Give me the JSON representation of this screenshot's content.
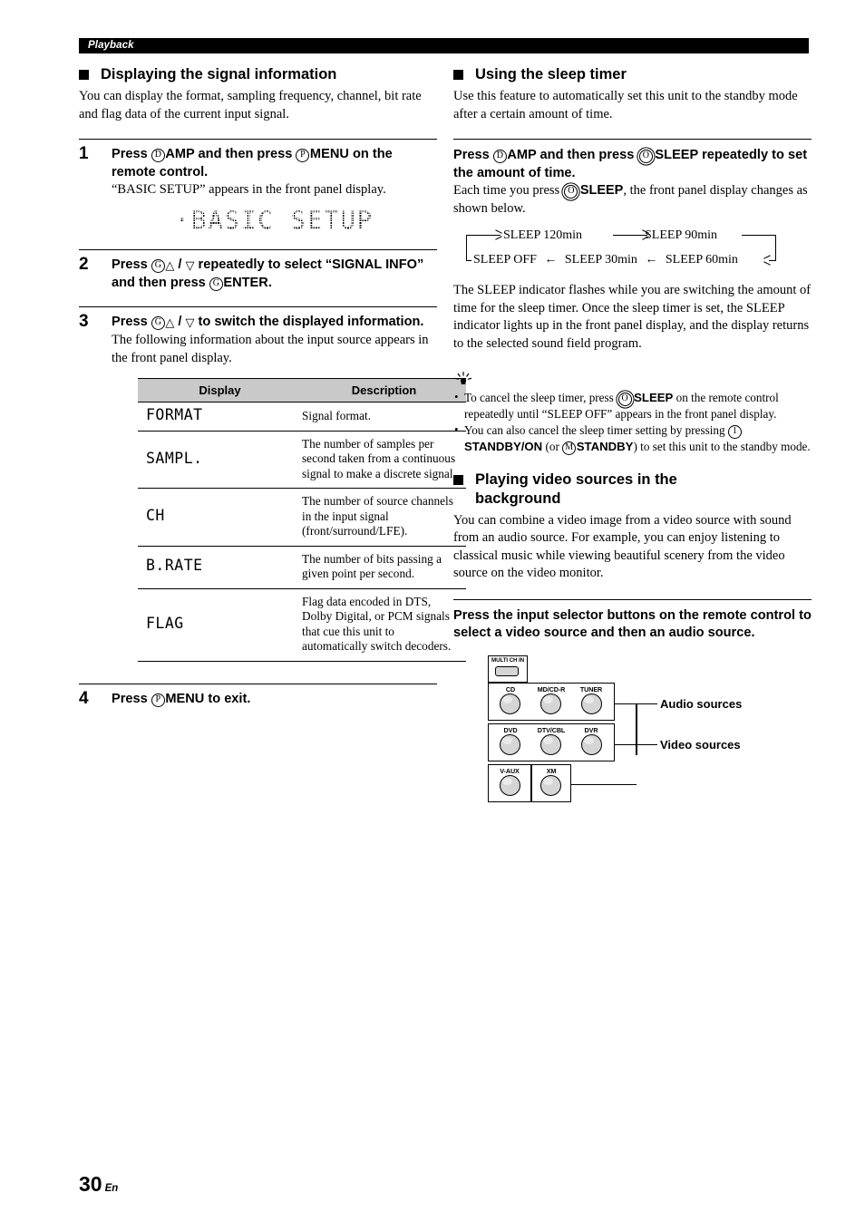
{
  "page": {
    "running_head": "Playback",
    "number": "30",
    "language": "En"
  },
  "left_column": {
    "section": {
      "heading": "Displaying the signal information",
      "intro": "You can display the format, sampling frequency, channel, bit rate and flag data of the current input signal."
    },
    "steps": [
      {
        "num": "1",
        "title_parts": {
          "a": "Press ",
          "marker1": "D",
          "b": "AMP",
          "c": " and then press ",
          "marker2": "P",
          "d": "MENU",
          "e": " on the remote control."
        },
        "body": "“BASIC SETUP” appears in the front panel display.",
        "lcd": "·BASIC SETUP"
      },
      {
        "num": "2",
        "title_parts": {
          "a": "Press ",
          "marker1": "G",
          "up": "△",
          "sep": " / ",
          "down": "▽",
          "b": " repeatedly to select “SIGNAL INFO” and then press ",
          "marker2": "G",
          "c": "ENTER."
        }
      },
      {
        "num": "3",
        "title_parts": {
          "a": "Press ",
          "marker1": "G",
          "up": "△",
          "sep": " / ",
          "down": "▽",
          "b": " to switch the displayed information."
        },
        "body": "The following information about the input source appears in the front panel display."
      },
      {
        "num": "4",
        "title_parts": {
          "a": "Press ",
          "marker1": "P",
          "b": "MENU",
          "c": " to exit."
        }
      }
    ],
    "table": {
      "headers": [
        "Display",
        "Description"
      ],
      "rows": [
        {
          "display": "FORMAT",
          "description": "Signal format."
        },
        {
          "display": "SAMPL.",
          "description": "The number of samples per second taken from a continuous signal to make a discrete signal."
        },
        {
          "display": "CH",
          "description": "The number of source channels in the input signal (front/surround/LFE)."
        },
        {
          "display": "B.RATE",
          "description": "The number of bits passing a given point per second."
        },
        {
          "display": "FLAG",
          "description": "Flag data encoded in DTS, Dolby Digital, or PCM signals that cue this unit to automatically switch decoders."
        }
      ]
    }
  },
  "right_column": {
    "sleep_section": {
      "heading": "Using the sleep timer",
      "intro": "Use this feature to automatically set this unit to the standby mode after a certain amount of time.",
      "instruction_parts": {
        "a": "Press ",
        "marker1": "D",
        "b": "AMP",
        "c": " and then press ",
        "marker2": "O",
        "d": "SLEEP",
        "e": " repeatedly to set the amount of time."
      },
      "sub_parts": {
        "a": "Each time you press ",
        "marker": "O",
        "b": "SLEEP",
        "c": ", the front panel display changes as shown below."
      },
      "cycle": {
        "top": [
          "SLEEP  120min",
          "SLEEP  90min"
        ],
        "bottom": [
          "SLEEP  OFF",
          "SLEEP  30min",
          "SLEEP  60min"
        ]
      },
      "explanation": "The SLEEP indicator flashes while you are switching the amount of time for the sleep timer. Once the sleep timer is set, the SLEEP indicator lights up in the front panel display, and the display returns to the selected sound field program.",
      "tips": [
        {
          "a": "To cancel the sleep timer, press ",
          "marker": "O",
          "b": "SLEEP",
          "c": " on the remote control repeatedly until “SLEEP OFF” appears in the front panel display."
        },
        {
          "a": "You can also cancel the sleep timer setting by pressing ",
          "marker1": "1",
          "b": "STANDBY/ON",
          "c": " (or ",
          "marker2": "M",
          "d": "STANDBY",
          "e": ") to set this unit to the standby mode."
        }
      ]
    },
    "video_section": {
      "heading_line1": "Playing video sources in the",
      "heading_line2": "background",
      "intro": "You can combine a video image from a video source with sound from an audio source. For example, you can enjoy listening to classical music while viewing beautiful scenery from the video source on the video monitor.",
      "instruction": "Press the input selector buttons on the remote control to select a video source and then an audio source."
    },
    "remote_diagram": {
      "multi_label": "MULTI CH IN",
      "buttons": [
        {
          "label": "CD"
        },
        {
          "label": "MD/CD-R"
        },
        {
          "label": "TUNER"
        },
        {
          "label": "DVD"
        },
        {
          "label": "DTV/CBL"
        },
        {
          "label": "DVR"
        },
        {
          "label": "V-AUX"
        },
        {
          "label": "XM"
        }
      ],
      "callouts": [
        "Audio sources",
        "Video sources"
      ]
    }
  }
}
